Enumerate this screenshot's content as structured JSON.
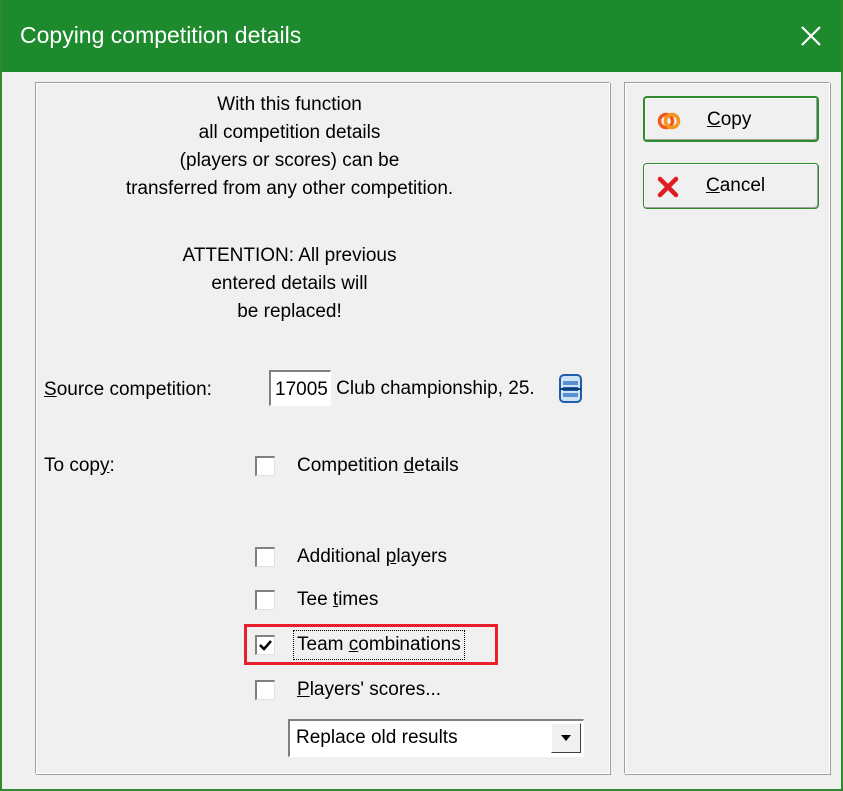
{
  "window": {
    "title": "Copying competition details",
    "close_glyph": "✕"
  },
  "intro_lines": [
    "With this function",
    "all competition details",
    "(players or scores) can be",
    "transferred from any other competition."
  ],
  "attention_lines": [
    "ATTENTION: All previous",
    "entered details will",
    "be replaced!"
  ],
  "source": {
    "label_u": "S",
    "label_rest": "ource competition:",
    "number": "17005",
    "name": "Club championship, 25.",
    "lookup_icon": "list-lookup-icon"
  },
  "to_copy": {
    "label_pre": "To cop",
    "label_u": "y",
    "label_post": ":"
  },
  "options": [
    {
      "pre": "Competition ",
      "u": "d",
      "post": "etails",
      "checked": false
    },
    {
      "pre": "Additional ",
      "u": "p",
      "post": "layers",
      "checked": false
    },
    {
      "pre": "Tee ",
      "u": "t",
      "post": "imes",
      "checked": false
    },
    {
      "pre": "Team ",
      "u": "c",
      "post": "ombinations",
      "checked": true
    },
    {
      "pre": "",
      "u": "P",
      "post": "layers' scores...",
      "checked": false
    }
  ],
  "results_mode": {
    "selected": "Replace old results"
  },
  "buttons": {
    "copy": {
      "u": "C",
      "rest": "opy",
      "icon": "copy-rings-icon"
    },
    "cancel": {
      "u": "C",
      "rest": "ancel",
      "icon": "red-x-icon"
    }
  },
  "colors": {
    "titlebar": "#1e8a2e",
    "highlight": "#e8202e",
    "cancel_icon": "#e01b24",
    "copy_icon": "#f05a1e"
  }
}
